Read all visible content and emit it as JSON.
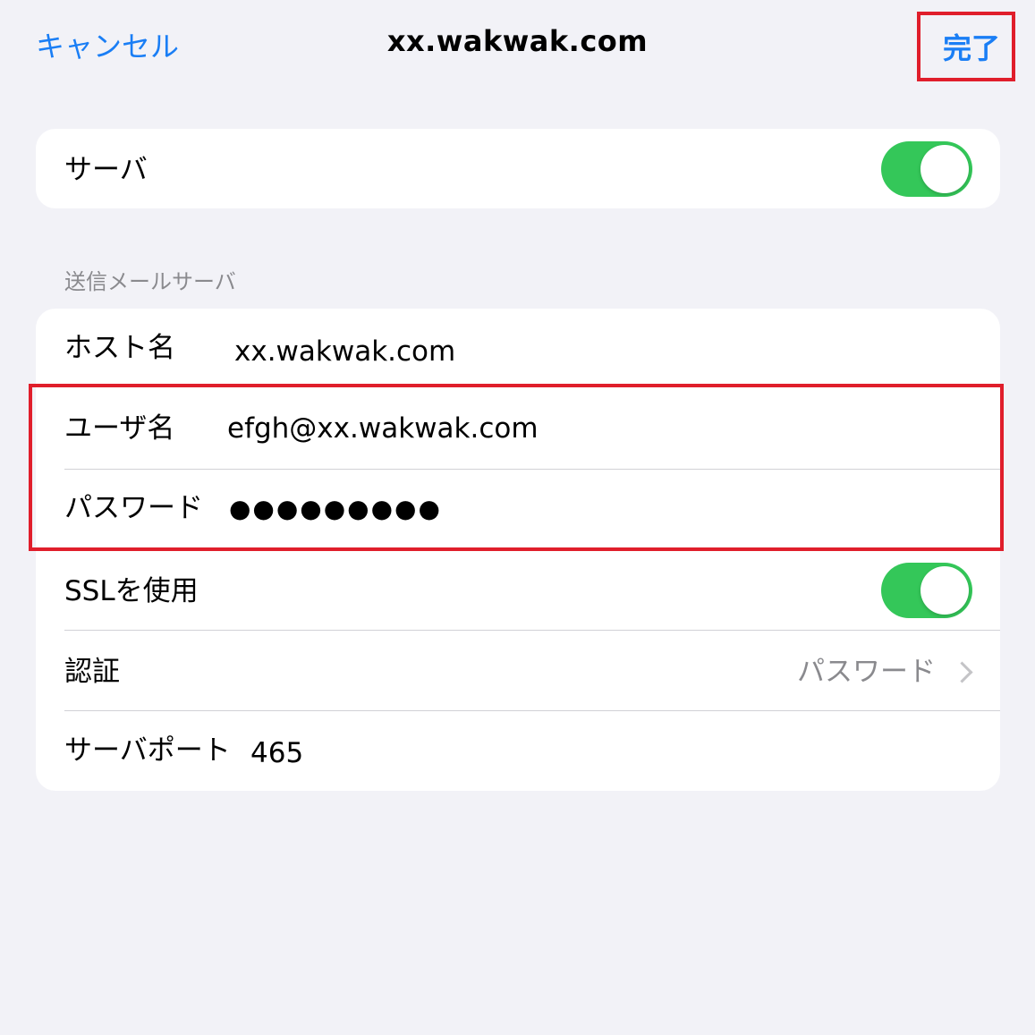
{
  "nav": {
    "cancel_label": "キャンセル",
    "title": "xx.wakwak.com",
    "done_label": "完了"
  },
  "server_card": {
    "label": "サーバ",
    "enabled": true
  },
  "outgoing": {
    "section_header": "送信メールサーバ",
    "host_label": "ホスト名",
    "host_value": "xx.wakwak.com",
    "username_label": "ユーザ名",
    "username_value": "efgh@xx.wakwak.com",
    "password_label": "パスワード",
    "password_value": "●●●●●●●●●",
    "ssl_label": "SSLを使用",
    "ssl_enabled": true,
    "auth_label": "認証",
    "auth_value": "パスワード",
    "port_label": "サーバポート",
    "port_value": "465"
  },
  "colors": {
    "accent": "#1a7ef5",
    "toggle_on": "#34c759",
    "highlight": "#e01e2b",
    "background": "#f2f2f7"
  },
  "icons": {
    "disclosure": "chevron-right-icon"
  }
}
